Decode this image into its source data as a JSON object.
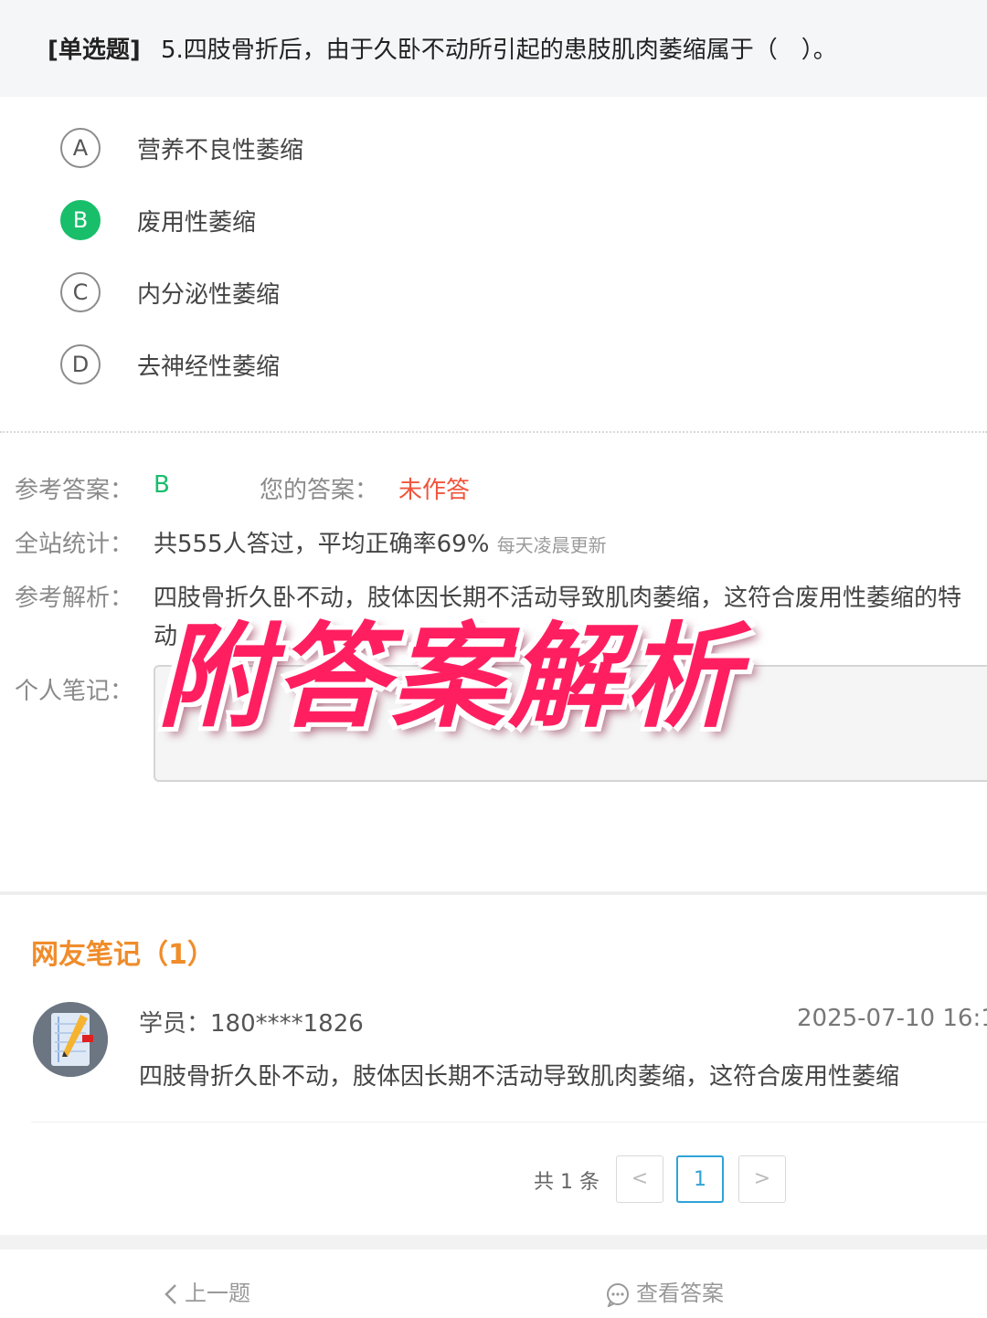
{
  "question": {
    "type": "[单选题]",
    "text": "5.四肢骨折后，由于久卧不动所引起的患肢肌肉萎缩属于（　）。"
  },
  "options": [
    {
      "letter": "A",
      "text": "营养不良性萎缩"
    },
    {
      "letter": "B",
      "text": "废用性萎缩"
    },
    {
      "letter": "C",
      "text": "内分泌性萎缩"
    },
    {
      "letter": "D",
      "text": "去神经性萎缩"
    }
  ],
  "answer": {
    "ref_label": "参考答案：",
    "ref_value": "B",
    "your_label": "您的答案：",
    "your_value": "未作答",
    "stats_label": "全站统计：",
    "stats_value": "共555人答过，平均正确率69%",
    "stats_note": "每天凌晨更新",
    "analysis_label": "参考解析：",
    "analysis_line1": "四肢骨折久卧不动，肢体因长期不活动导致肌肉萎缩，这符合废用性萎缩的特",
    "analysis_line2": "动",
    "notes_label": "个人笔记："
  },
  "overlay_text": "附答案解析",
  "peer_notes": {
    "title": "网友笔记（1）",
    "items": [
      {
        "user": "学员：180****1826",
        "time": "2025-07-10 16:1",
        "content": "四肢骨折久卧不动，肢体因长期不活动导致肌肉萎缩，这符合废用性萎缩"
      }
    ]
  },
  "pagination": {
    "total": "共 1 条",
    "prev": "<",
    "page": "1",
    "next": ">"
  },
  "bottom_nav": {
    "prev": "上一题",
    "view_answer": "查看答案"
  },
  "colors": {
    "correct": "#19be6b",
    "unanswered": "#f0543c",
    "notes_title": "#f08c2a",
    "active_page": "#2fa3d8",
    "overlay": "#ff1f60"
  }
}
